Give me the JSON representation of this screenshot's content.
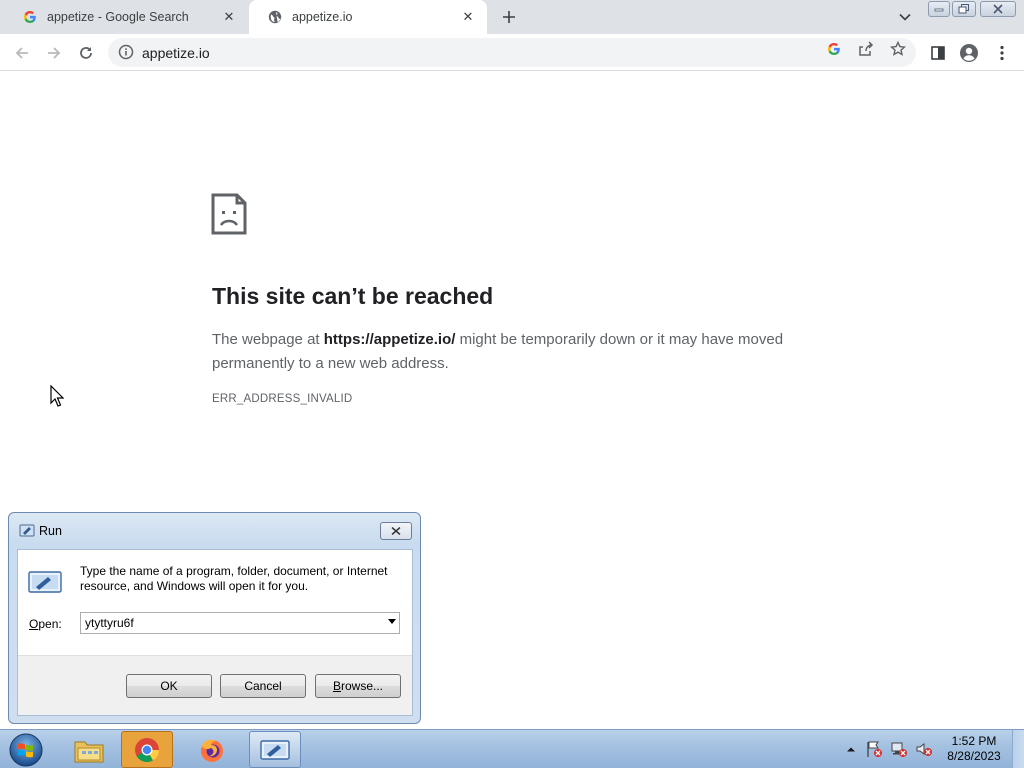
{
  "browser": {
    "tabs": [
      {
        "title": "appetize - Google Search",
        "icon": "google-g-icon",
        "active": false
      },
      {
        "title": "appetize.io",
        "icon": "globe-icon",
        "active": true
      }
    ],
    "address": "appetize.io"
  },
  "error_page": {
    "title": "This site can’t be reached",
    "desc_prefix": "The webpage at ",
    "url": "https://appetize.io/",
    "desc_suffix": " might be temporarily down or it may have moved permanently to a new web address.",
    "code": "ERR_ADDRESS_INVALID"
  },
  "run_dialog": {
    "title": "Run",
    "description": "Type the name of a program, folder, document, or Internet resource, and Windows will open it for you.",
    "open_label_accel": "O",
    "open_label_rest": "pen:",
    "input_value": "ytyttyru6f",
    "ok_label": "OK",
    "cancel_label": "Cancel",
    "browse_accel": "B",
    "browse_rest": "rowse..."
  },
  "taskbar": {
    "time": "1:52 PM",
    "date": "8/28/2023"
  },
  "colors": {
    "chrome_bg": "#dee1e6",
    "omnibox_bg": "#f1f3f4",
    "error_title": "#202124",
    "error_text": "#5f6368",
    "taskbar": "#a3c0e0"
  }
}
